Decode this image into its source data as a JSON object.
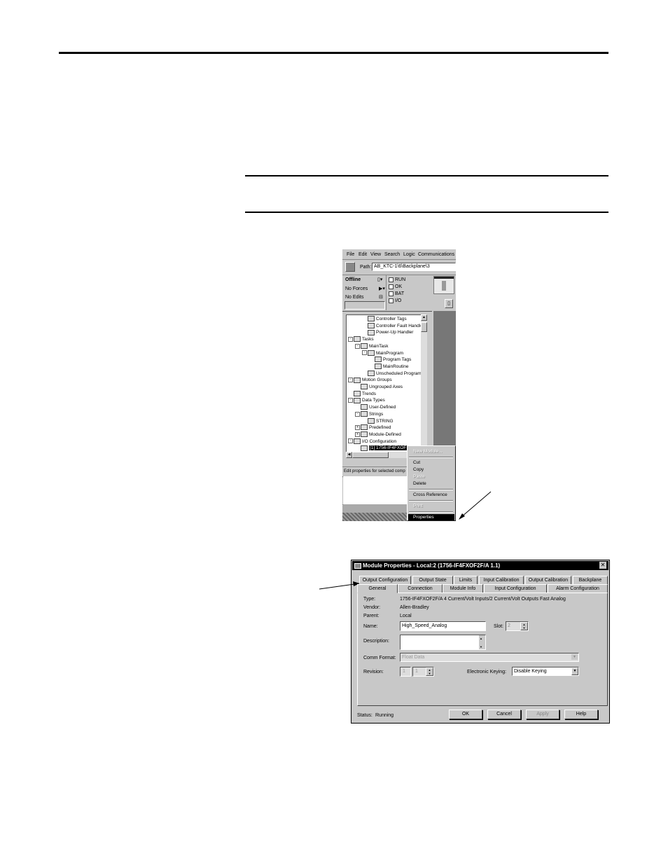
{
  "upper_window": {
    "menu": [
      "File",
      "Edit",
      "View",
      "Search",
      "Logic",
      "Communications"
    ],
    "path_label": "Path:",
    "path_value": "AB_KTC-1\\6\\Backplane\\3",
    "status": {
      "mode": "Offline",
      "forces": "No Forces",
      "edits": "No Edits",
      "indicators": [
        "RUN",
        "OK",
        "BAT",
        "I/O"
      ]
    },
    "tree": [
      {
        "label": "Controller Tags",
        "indent": 2,
        "pm": ""
      },
      {
        "label": "Controller Fault Handler",
        "indent": 2,
        "pm": ""
      },
      {
        "label": "Power-Up Handler",
        "indent": 2,
        "pm": ""
      },
      {
        "label": "Tasks",
        "indent": 0,
        "pm": "-"
      },
      {
        "label": "MainTask",
        "indent": 1,
        "pm": "-"
      },
      {
        "label": "MainProgram",
        "indent": 2,
        "pm": "-"
      },
      {
        "label": "Program Tags",
        "indent": 3,
        "pm": ""
      },
      {
        "label": "MainRoutine",
        "indent": 3,
        "pm": ""
      },
      {
        "label": "Unscheduled Programs",
        "indent": 2,
        "pm": ""
      },
      {
        "label": "Motion Groups",
        "indent": 0,
        "pm": "-"
      },
      {
        "label": "Ungrouped Axes",
        "indent": 1,
        "pm": ""
      },
      {
        "label": "Trends",
        "indent": 0,
        "pm": ""
      },
      {
        "label": "Data Types",
        "indent": 0,
        "pm": "-"
      },
      {
        "label": "User-Defined",
        "indent": 1,
        "pm": ""
      },
      {
        "label": "Strings",
        "indent": 1,
        "pm": "-"
      },
      {
        "label": "STRING",
        "indent": 2,
        "pm": ""
      },
      {
        "label": "Predefined",
        "indent": 1,
        "pm": "+"
      },
      {
        "label": "Module-Defined",
        "indent": 1,
        "pm": "+"
      },
      {
        "label": "I/O Configuration",
        "indent": 0,
        "pm": "-"
      },
      {
        "label": "[1] 1756-IF4FXOF",
        "indent": 1,
        "pm": "",
        "selected": true
      }
    ],
    "statusbar": "Edit properties for selected comp",
    "context_menu": [
      {
        "label": "New Module...",
        "disabled": true,
        "sep_after": true
      },
      {
        "label": "Cut",
        "disabled": false
      },
      {
        "label": "Copy",
        "disabled": false
      },
      {
        "label": "Paste",
        "disabled": true
      },
      {
        "label": "Delete",
        "disabled": false,
        "sep_after": true
      },
      {
        "label": "Cross Reference",
        "disabled": false,
        "sep_after": true
      },
      {
        "label": "Print",
        "disabled": true,
        "sep_after": true
      },
      {
        "label": "Properties",
        "disabled": false,
        "highlighted": true
      }
    ]
  },
  "dialog": {
    "title": "Module Properties - Local:2 (1756-IF4FXOF2F/A 1.1)",
    "tabs_back": [
      "Output Configuration",
      "Output State",
      "Limits",
      "Input Calibration",
      "Output Calibration",
      "Backplane"
    ],
    "tabs_front": [
      "General",
      "Connection",
      "Module Info",
      "Input Configuration",
      "Alarm Configuration"
    ],
    "fields": {
      "type_label": "Type:",
      "type_value": "1756-IF4FXOF2F/A 4 Current/Volt Inputs/2 Current/Volt Outputs Fast Analog",
      "vendor_label": "Vendor:",
      "vendor_value": "Allen-Bradley",
      "parent_label": "Parent:",
      "parent_value": "Local",
      "name_label": "Name:",
      "name_value": "High_Speed_Analog",
      "slot_label": "Slot:",
      "slot_value": "2",
      "description_label": "Description:",
      "comm_format_label": "Comm Format:",
      "comm_format_value": "Float Data",
      "revision_label": "Revision:",
      "revision_major": "1",
      "revision_minor": "1",
      "keying_label": "Electronic Keying:",
      "keying_value": "Disable Keying"
    },
    "status_label": "Status:",
    "status_value": "Running",
    "buttons": {
      "ok": "OK",
      "cancel": "Cancel",
      "apply": "Apply",
      "help": "Help"
    }
  }
}
